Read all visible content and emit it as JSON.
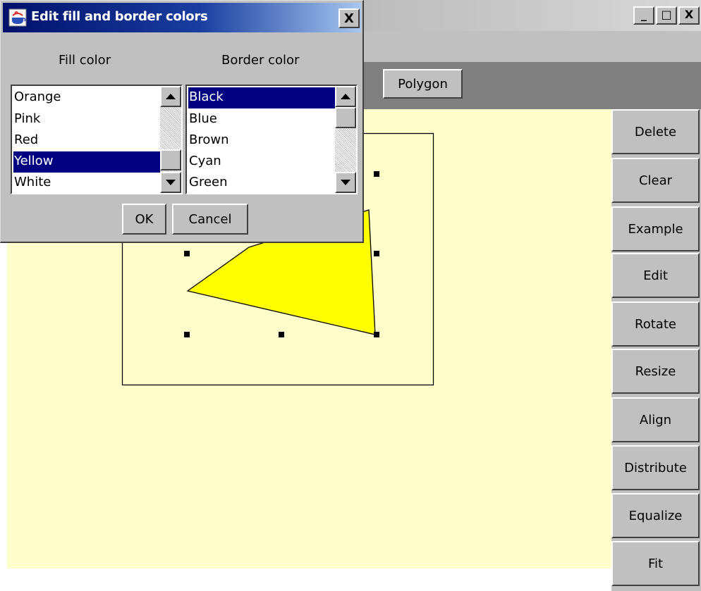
{
  "main_window": {
    "buttons": {
      "minimize": "_",
      "maximize": "□",
      "close": "X"
    }
  },
  "toolbar": {
    "polygon_label": "Polygon"
  },
  "side_panel": {
    "buttons": [
      {
        "label": "Delete"
      },
      {
        "label": "Clear"
      },
      {
        "label": "Example"
      },
      {
        "label": "Edit"
      },
      {
        "label": "Rotate"
      },
      {
        "label": "Resize"
      },
      {
        "label": "Align"
      },
      {
        "label": "Distribute"
      },
      {
        "label": "Equalize"
      },
      {
        "label": "Fit"
      }
    ]
  },
  "dialog": {
    "title": "Edit fill and border colors",
    "close_label": "X",
    "fill_label": "Fill color",
    "border_label": "Border color",
    "fill_items": [
      "Orange",
      "Pink",
      "Red",
      "Yellow",
      "White"
    ],
    "fill_selected": "Yellow",
    "border_items": [
      "Black",
      "Blue",
      "Brown",
      "Cyan",
      "Green"
    ],
    "border_selected": "Black",
    "ok_label": "OK",
    "cancel_label": "Cancel"
  },
  "canvas": {
    "shape_fill": "#ffff00",
    "shape_border": "#000000",
    "background": "#ffffcc"
  },
  "colors": {
    "selection": "#000080",
    "panel": "#c0c0c0",
    "toolbar": "#808080"
  },
  "icons": {
    "dialog": "java-cup-icon",
    "scroll_up": "arrow-up-icon",
    "scroll_down": "arrow-down-icon"
  }
}
